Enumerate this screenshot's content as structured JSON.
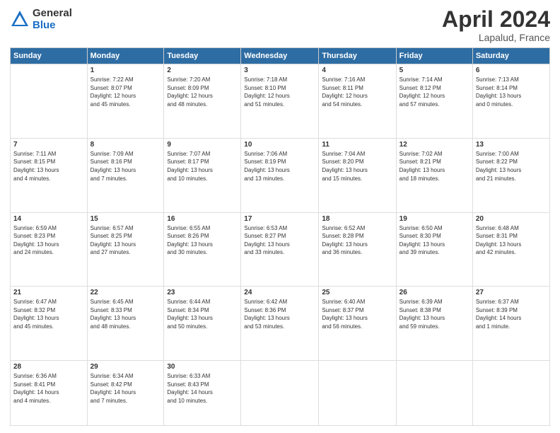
{
  "header": {
    "logo_line1": "General",
    "logo_line2": "Blue",
    "title": "April 2024",
    "location": "Lapalud, France"
  },
  "columns": [
    "Sunday",
    "Monday",
    "Tuesday",
    "Wednesday",
    "Thursday",
    "Friday",
    "Saturday"
  ],
  "weeks": [
    [
      {
        "day": "",
        "info": ""
      },
      {
        "day": "1",
        "info": "Sunrise: 7:22 AM\nSunset: 8:07 PM\nDaylight: 12 hours\nand 45 minutes."
      },
      {
        "day": "2",
        "info": "Sunrise: 7:20 AM\nSunset: 8:09 PM\nDaylight: 12 hours\nand 48 minutes."
      },
      {
        "day": "3",
        "info": "Sunrise: 7:18 AM\nSunset: 8:10 PM\nDaylight: 12 hours\nand 51 minutes."
      },
      {
        "day": "4",
        "info": "Sunrise: 7:16 AM\nSunset: 8:11 PM\nDaylight: 12 hours\nand 54 minutes."
      },
      {
        "day": "5",
        "info": "Sunrise: 7:14 AM\nSunset: 8:12 PM\nDaylight: 12 hours\nand 57 minutes."
      },
      {
        "day": "6",
        "info": "Sunrise: 7:13 AM\nSunset: 8:14 PM\nDaylight: 13 hours\nand 0 minutes."
      }
    ],
    [
      {
        "day": "7",
        "info": "Sunrise: 7:11 AM\nSunset: 8:15 PM\nDaylight: 13 hours\nand 4 minutes."
      },
      {
        "day": "8",
        "info": "Sunrise: 7:09 AM\nSunset: 8:16 PM\nDaylight: 13 hours\nand 7 minutes."
      },
      {
        "day": "9",
        "info": "Sunrise: 7:07 AM\nSunset: 8:17 PM\nDaylight: 13 hours\nand 10 minutes."
      },
      {
        "day": "10",
        "info": "Sunrise: 7:06 AM\nSunset: 8:19 PM\nDaylight: 13 hours\nand 13 minutes."
      },
      {
        "day": "11",
        "info": "Sunrise: 7:04 AM\nSunset: 8:20 PM\nDaylight: 13 hours\nand 15 minutes."
      },
      {
        "day": "12",
        "info": "Sunrise: 7:02 AM\nSunset: 8:21 PM\nDaylight: 13 hours\nand 18 minutes."
      },
      {
        "day": "13",
        "info": "Sunrise: 7:00 AM\nSunset: 8:22 PM\nDaylight: 13 hours\nand 21 minutes."
      }
    ],
    [
      {
        "day": "14",
        "info": "Sunrise: 6:59 AM\nSunset: 8:23 PM\nDaylight: 13 hours\nand 24 minutes."
      },
      {
        "day": "15",
        "info": "Sunrise: 6:57 AM\nSunset: 8:25 PM\nDaylight: 13 hours\nand 27 minutes."
      },
      {
        "day": "16",
        "info": "Sunrise: 6:55 AM\nSunset: 8:26 PM\nDaylight: 13 hours\nand 30 minutes."
      },
      {
        "day": "17",
        "info": "Sunrise: 6:53 AM\nSunset: 8:27 PM\nDaylight: 13 hours\nand 33 minutes."
      },
      {
        "day": "18",
        "info": "Sunrise: 6:52 AM\nSunset: 8:28 PM\nDaylight: 13 hours\nand 36 minutes."
      },
      {
        "day": "19",
        "info": "Sunrise: 6:50 AM\nSunset: 8:30 PM\nDaylight: 13 hours\nand 39 minutes."
      },
      {
        "day": "20",
        "info": "Sunrise: 6:48 AM\nSunset: 8:31 PM\nDaylight: 13 hours\nand 42 minutes."
      }
    ],
    [
      {
        "day": "21",
        "info": "Sunrise: 6:47 AM\nSunset: 8:32 PM\nDaylight: 13 hours\nand 45 minutes."
      },
      {
        "day": "22",
        "info": "Sunrise: 6:45 AM\nSunset: 8:33 PM\nDaylight: 13 hours\nand 48 minutes."
      },
      {
        "day": "23",
        "info": "Sunrise: 6:44 AM\nSunset: 8:34 PM\nDaylight: 13 hours\nand 50 minutes."
      },
      {
        "day": "24",
        "info": "Sunrise: 6:42 AM\nSunset: 8:36 PM\nDaylight: 13 hours\nand 53 minutes."
      },
      {
        "day": "25",
        "info": "Sunrise: 6:40 AM\nSunset: 8:37 PM\nDaylight: 13 hours\nand 56 minutes."
      },
      {
        "day": "26",
        "info": "Sunrise: 6:39 AM\nSunset: 8:38 PM\nDaylight: 13 hours\nand 59 minutes."
      },
      {
        "day": "27",
        "info": "Sunrise: 6:37 AM\nSunset: 8:39 PM\nDaylight: 14 hours\nand 1 minute."
      }
    ],
    [
      {
        "day": "28",
        "info": "Sunrise: 6:36 AM\nSunset: 8:41 PM\nDaylight: 14 hours\nand 4 minutes."
      },
      {
        "day": "29",
        "info": "Sunrise: 6:34 AM\nSunset: 8:42 PM\nDaylight: 14 hours\nand 7 minutes."
      },
      {
        "day": "30",
        "info": "Sunrise: 6:33 AM\nSunset: 8:43 PM\nDaylight: 14 hours\nand 10 minutes."
      },
      {
        "day": "",
        "info": ""
      },
      {
        "day": "",
        "info": ""
      },
      {
        "day": "",
        "info": ""
      },
      {
        "day": "",
        "info": ""
      }
    ]
  ]
}
